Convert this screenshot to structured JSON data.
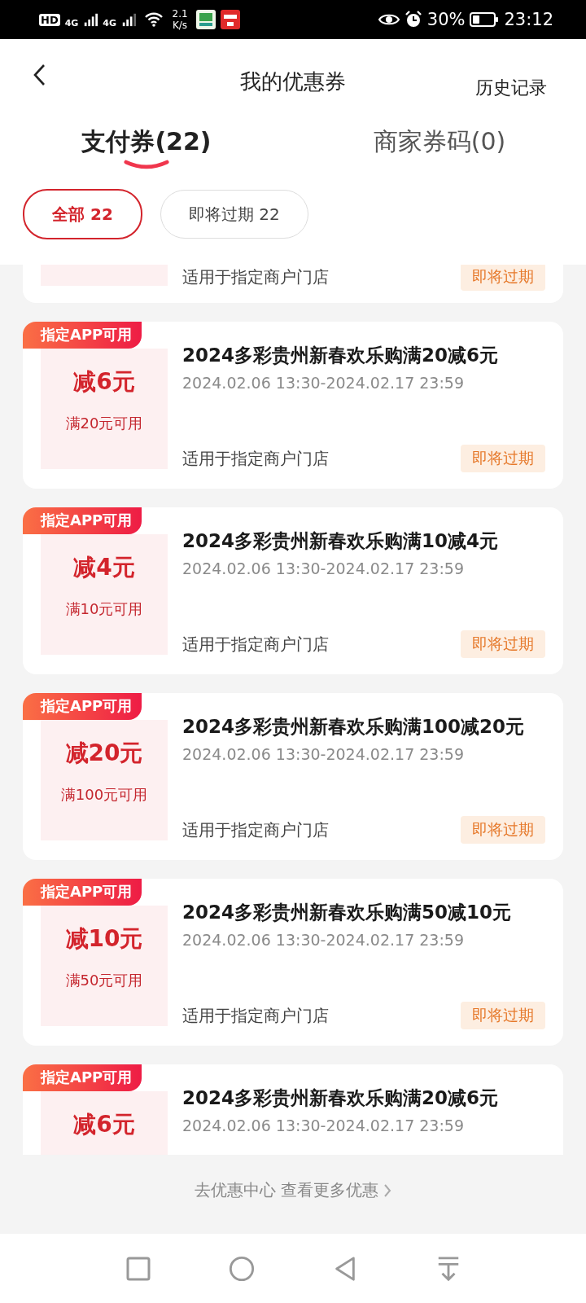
{
  "status_bar": {
    "hd": "HD",
    "sim1": "4G",
    "sim2": "4G",
    "speed": "2.1 K/s",
    "battery": "30%",
    "time": "23:12"
  },
  "header": {
    "title": "我的优惠券",
    "history": "历史记录"
  },
  "tabs": [
    {
      "label": "支付券(22)",
      "selected": true
    },
    {
      "label": "商家券码(0)",
      "selected": false
    }
  ],
  "filters": [
    {
      "label": "全部 22",
      "selected": true
    },
    {
      "label": "即将过期 22",
      "selected": false
    }
  ],
  "coupons": [
    {
      "scope": "适用于指定商户门店",
      "status": "即将过期"
    },
    {
      "badge": "指定APP可用",
      "amount": "减6元",
      "min": "满20元可用",
      "title": "2024多彩贵州新春欢乐购满20减6元",
      "dates": "2024.02.06 13:30-2024.02.17 23:59",
      "scope": "适用于指定商户门店",
      "status": "即将过期"
    },
    {
      "badge": "指定APP可用",
      "amount": "减4元",
      "min": "满10元可用",
      "title": "2024多彩贵州新春欢乐购满10减4元",
      "dates": "2024.02.06 13:30-2024.02.17 23:59",
      "scope": "适用于指定商户门店",
      "status": "即将过期"
    },
    {
      "badge": "指定APP可用",
      "amount": "减20元",
      "min": "满100元可用",
      "title": "2024多彩贵州新春欢乐购满100减20元",
      "dates": "2024.02.06 13:30-2024.02.17 23:59",
      "scope": "适用于指定商户门店",
      "status": "即将过期"
    },
    {
      "badge": "指定APP可用",
      "amount": "减10元",
      "min": "满50元可用",
      "title": "2024多彩贵州新春欢乐购满50减10元",
      "dates": "2024.02.06 13:30-2024.02.17 23:59",
      "scope": "适用于指定商户门店",
      "status": "即将过期"
    },
    {
      "badge": "指定APP可用",
      "amount": "减6元",
      "title": "2024多彩贵州新春欢乐购满20减6元",
      "dates": "2024.02.06 13:30-2024.02.17 23:59"
    }
  ],
  "footer_link": "去优惠中心 查看更多优惠"
}
